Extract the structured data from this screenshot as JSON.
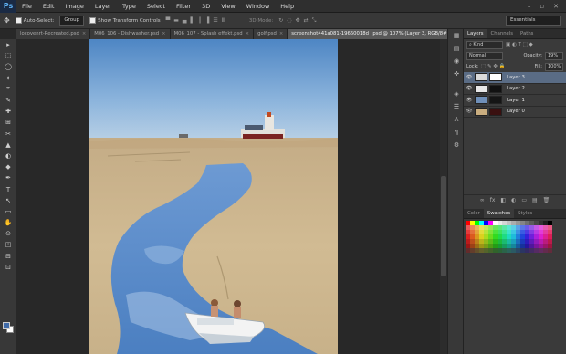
{
  "app": {
    "logo": "Ps"
  },
  "menu": [
    "File",
    "Edit",
    "Image",
    "Layer",
    "Type",
    "Select",
    "Filter",
    "3D",
    "View",
    "Window",
    "Help"
  ],
  "window_controls": [
    "–",
    "▫",
    "✕"
  ],
  "options": {
    "auto_select_label": "Auto-Select:",
    "auto_select_value": "Group",
    "transform_label": "Show Transform Controls",
    "mode_3d_label": "3D Mode:",
    "workspace": "Essentials"
  },
  "tabs": [
    {
      "label": "locovenrt-Recreated.psd",
      "active": false
    },
    {
      "label": "M06_106 - Dishwasher.psd",
      "active": false
    },
    {
      "label": "M06_107 - Splash effekt.psd",
      "active": false
    },
    {
      "label": "golf.psd",
      "active": false
    },
    {
      "label": "screenshot441a081-19660018d_.psd @ 107% (Layer 3, RGB/8#)",
      "active": true
    }
  ],
  "tools": [
    "▸",
    "⬚",
    "◯",
    "✦",
    "⌗",
    "✎",
    "✚",
    "⊞",
    "✂",
    "▲",
    "◐",
    "◆",
    "✒",
    "T",
    "↖",
    "▭",
    "✋",
    "⊙",
    "◳",
    "⊟",
    "⊡"
  ],
  "panel_icons": [
    "▦",
    "▤",
    "◉",
    "✜",
    "◈",
    "☰",
    "A",
    "¶",
    "⚙"
  ],
  "layers_panel": {
    "tabs": [
      {
        "label": "Layers",
        "active": true
      },
      {
        "label": "Channels",
        "active": false
      },
      {
        "label": "Paths",
        "active": false
      }
    ],
    "kind_label": "Kind",
    "blend_mode": "Normal",
    "opacity_label": "Opacity:",
    "opacity_value": "19%",
    "lock_label": "Lock:",
    "fill_label": "Fill:",
    "fill_value": "100%",
    "layers": [
      {
        "name": "Layer 3",
        "selected": true,
        "thumb": "#dadada",
        "mask": "#ffffff"
      },
      {
        "name": "Layer 2",
        "selected": false,
        "thumb": "#e8e8e8",
        "mask": "#111111"
      },
      {
        "name": "Layer 1",
        "selected": false,
        "thumb": "#6f8fb8",
        "mask": "#151515"
      },
      {
        "name": "Layer 0",
        "selected": false,
        "thumb": "#c9ad7f",
        "mask": "#3a1010"
      }
    ],
    "footer_icons": [
      "∞",
      "fx",
      "◧",
      "◐",
      "▭",
      "▤",
      "🗑"
    ]
  },
  "swatches_panel": {
    "tabs": [
      {
        "label": "Color",
        "active": false
      },
      {
        "label": "Swatches",
        "active": true
      },
      {
        "label": "Styles",
        "active": false
      }
    ]
  },
  "colors": {
    "fg": "#3f6aa8",
    "bg": "#ffffff",
    "selection": "#5a6c85"
  }
}
